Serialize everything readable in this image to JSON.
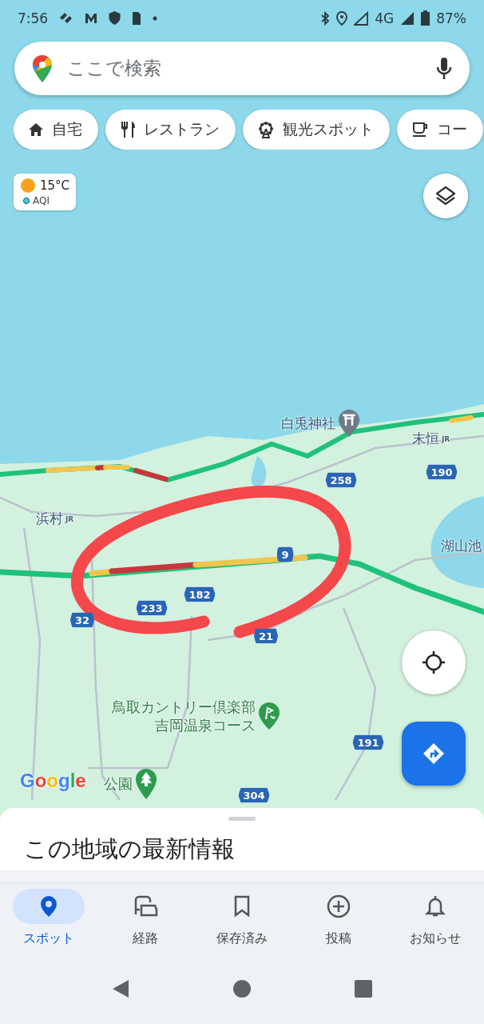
{
  "status_bar": {
    "time": "7:56",
    "network": "4G",
    "battery": "87%"
  },
  "search": {
    "placeholder": "ここで検索"
  },
  "chips": [
    {
      "label": "自宅",
      "kind": "home"
    },
    {
      "label": "レストラン",
      "kind": "restaurant"
    },
    {
      "label": "観光スポット",
      "kind": "sights"
    },
    {
      "label": "コー",
      "kind": "cafe"
    }
  ],
  "weather": {
    "temperature": "15°C",
    "aqi": "AQI"
  },
  "map": {
    "places": [
      {
        "name": "白兎神社",
        "kind": "shrine"
      },
      {
        "name": "末恒",
        "kind": "station",
        "badge": "JR"
      },
      {
        "name": "浜村",
        "kind": "station",
        "badge": "JR"
      },
      {
        "name": "湖山池",
        "kind": "plain"
      },
      {
        "lines": [
          "鳥取カントリー倶楽部",
          "吉岡温泉コース"
        ],
        "kind": "golf"
      },
      {
        "name": "公園",
        "kind": "park"
      }
    ],
    "route_shields": [
      "258",
      "190",
      "9",
      "182",
      "233",
      "32",
      "21",
      "191",
      "304"
    ],
    "attribution": "Google"
  },
  "sheet": {
    "title": "この地域の最新情報"
  },
  "nav": [
    {
      "label": "スポット",
      "kind": "explore",
      "selected": true
    },
    {
      "label": "経路",
      "kind": "commute",
      "selected": false
    },
    {
      "label": "保存済み",
      "kind": "saved",
      "selected": false
    },
    {
      "label": "投稿",
      "kind": "contribute",
      "selected": false
    },
    {
      "label": "お知らせ",
      "kind": "updates",
      "selected": false
    }
  ]
}
